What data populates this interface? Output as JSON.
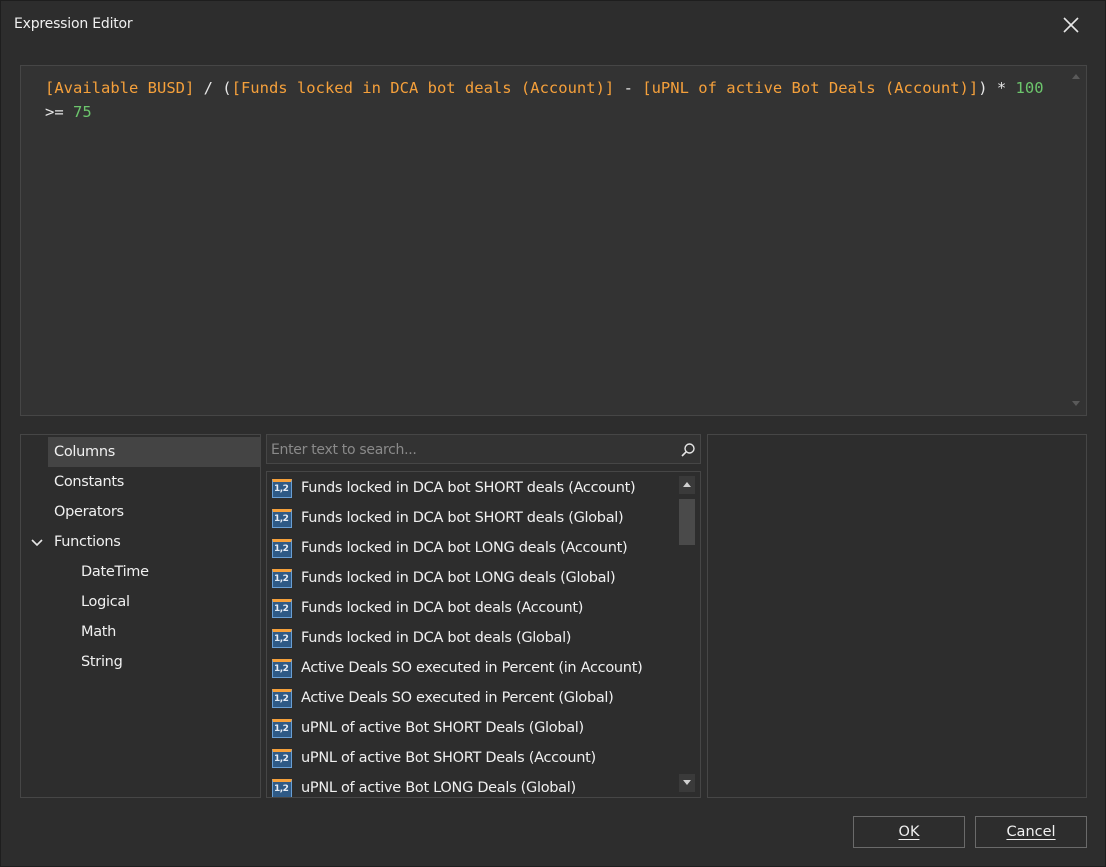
{
  "window": {
    "title": "Expression Editor"
  },
  "editor": {
    "tokens": [
      {
        "type": "field",
        "text": "[Available BUSD]"
      },
      {
        "type": "op",
        "text": " / ("
      },
      {
        "type": "field",
        "text": "[Funds locked in DCA bot deals (Account)]"
      },
      {
        "type": "op",
        "text": " - "
      },
      {
        "type": "field",
        "text": "[uPNL of active Bot Deals (Account)]"
      },
      {
        "type": "op",
        "text": ") * "
      },
      {
        "type": "num",
        "text": "100"
      },
      {
        "type": "op",
        "text": " >= "
      },
      {
        "type": "num",
        "text": "75"
      }
    ]
  },
  "categories": {
    "items": [
      {
        "label": "Columns",
        "selected": true
      },
      {
        "label": "Constants"
      },
      {
        "label": "Operators"
      },
      {
        "label": "Functions",
        "expanded": true
      },
      {
        "label": "DateTime",
        "child": true
      },
      {
        "label": "Logical",
        "child": true
      },
      {
        "label": "Math",
        "child": true
      },
      {
        "label": "String",
        "child": true
      }
    ]
  },
  "search": {
    "placeholder": "Enter text to search..."
  },
  "columns_list": {
    "icon_text": "1,2",
    "items": [
      "Funds locked in DCA bot SHORT deals (Account)",
      "Funds locked in DCA bot SHORT deals (Global)",
      "Funds locked in DCA bot LONG deals (Account)",
      "Funds locked in DCA bot LONG deals (Global)",
      "Funds locked in DCA bot deals (Account)",
      "Funds locked in DCA bot deals (Global)",
      "Active Deals SO executed in Percent (in Account)",
      "Active Deals SO executed in Percent (Global)",
      "uPNL of active Bot SHORT Deals (Global)",
      "uPNL of active Bot SHORT Deals (Account)",
      "uPNL of active Bot LONG Deals (Global)"
    ]
  },
  "buttons": {
    "ok": "OK",
    "cancel": "Cancel"
  },
  "colors": {
    "field": "#f5a03b",
    "number": "#6cc56c",
    "background": "#2d2d2d"
  }
}
